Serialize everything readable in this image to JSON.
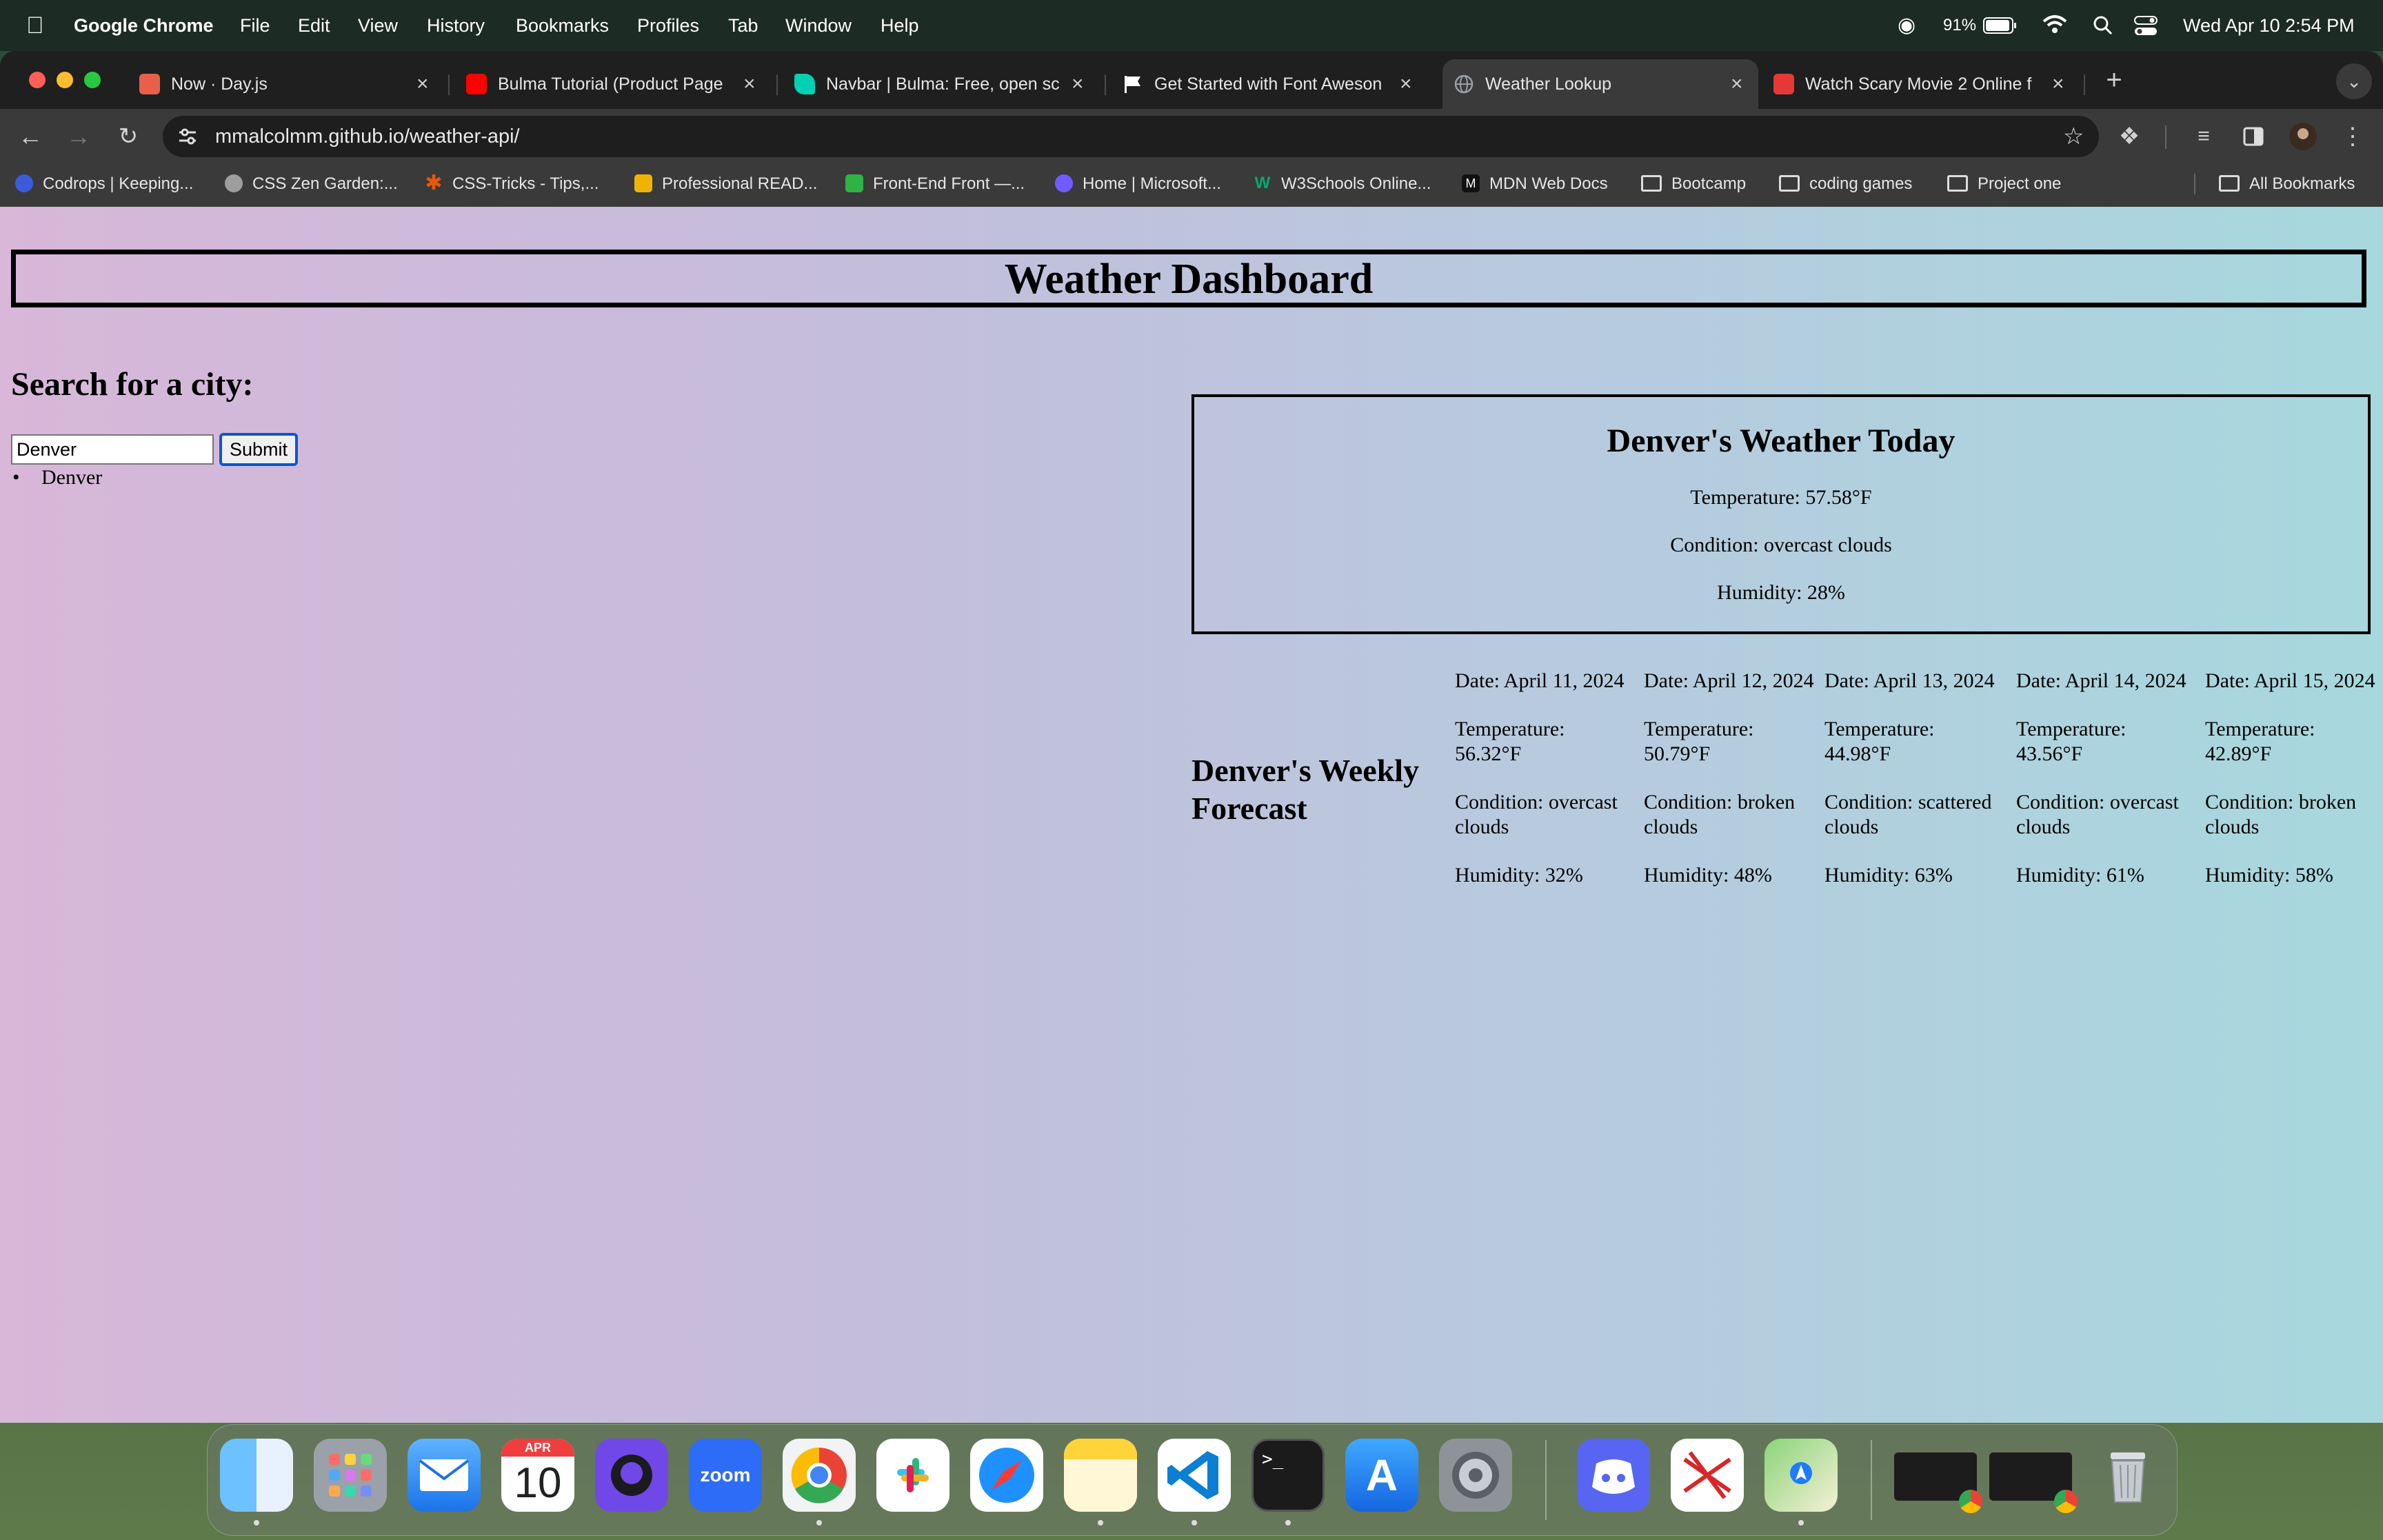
{
  "menubar": {
    "app_name": "Google Chrome",
    "menus": [
      "File",
      "Edit",
      "View",
      "History",
      "Bookmarks",
      "Profiles",
      "Tab",
      "Window",
      "Help"
    ],
    "battery": "91%",
    "datetime": "Wed Apr 10  2:54 PM"
  },
  "tabs": [
    {
      "title": "Now · Day.js",
      "color": "#e8604c"
    },
    {
      "title": "Bulma Tutorial (Product Page",
      "color": "#ff0000"
    },
    {
      "title": "Navbar | Bulma: Free, open sc",
      "color": "#00d1b2"
    },
    {
      "title": "Get Started with Font Aweson",
      "color": "#ffffff"
    },
    {
      "title": "Weather Lookup",
      "color": "#9aa0a6"
    },
    {
      "title": "Watch Scary Movie 2 Online f",
      "color": "#e53935"
    }
  ],
  "active_tab_index": 4,
  "address_bar": {
    "url": "mmalcolmm.github.io/weather-api/"
  },
  "bookmarks": [
    {
      "label": "Codrops | Keeping...",
      "color": "#3b5bdb"
    },
    {
      "label": "CSS Zen Garden:...",
      "color": "#9e9e9e"
    },
    {
      "label": "CSS-Tricks - Tips,...",
      "color": "#e8590c"
    },
    {
      "label": "Professional READ...",
      "color": "#f0b400"
    },
    {
      "label": "Front-End Front —...",
      "color": "#2fb344"
    },
    {
      "label": "Home | Microsoft...",
      "color": "#6f5cff"
    },
    {
      "label": "W3Schools Online...",
      "color": "#04aa6d"
    },
    {
      "label": "MDN Web Docs",
      "color": "#111111"
    },
    {
      "label": "Bootcamp",
      "color": "folder"
    },
    {
      "label": "coding games",
      "color": "folder"
    },
    {
      "label": "Project one",
      "color": "folder"
    }
  ],
  "all_bookmarks_label": "All Bookmarks",
  "page": {
    "title": "Weather Dashboard",
    "search_heading": "Search for a city:",
    "search_value": "Denver",
    "submit_label": "Submit",
    "history": [
      "Denver"
    ],
    "today": {
      "heading": "Denver's Weather Today",
      "temperature": "Temperature: 57.58°F",
      "condition": "Condition: overcast clouds",
      "humidity": "Humidity: 28%"
    },
    "weekly_heading": "Denver's Weekly Forecast",
    "forecast": [
      {
        "date": "Date: April 11, 2024",
        "temperature": "Temperature: 56.32°F",
        "condition": "Condition: overcast clouds",
        "humidity": "Humidity: 32%"
      },
      {
        "date": "Date: April 12, 2024",
        "temperature": "Temperature: 50.79°F",
        "condition": "Condition: broken clouds",
        "humidity": "Humidity: 48%"
      },
      {
        "date": "Date: April 13, 2024",
        "temperature": "Temperature: 44.98°F",
        "condition": "Condition: scattered clouds",
        "humidity": "Humidity: 63%"
      },
      {
        "date": "Date: April 14, 2024",
        "temperature": "Temperature: 43.56°F",
        "condition": "Condition: overcast clouds",
        "humidity": "Humidity: 61%"
      },
      {
        "date": "Date: April 15, 2024",
        "temperature": "Temperature: 42.89°F",
        "condition": "Condition: broken clouds",
        "humidity": "Humidity: 58%"
      }
    ]
  },
  "dock": {
    "calendar_month": "APR",
    "calendar_day": "10",
    "zoom_label": "zoom",
    "apps": [
      "finder-icon",
      "launchpad-icon",
      "mail-icon",
      "calendar-icon",
      "github-desktop-icon",
      "zoom-icon",
      "chrome-icon",
      "slack-icon",
      "safari-icon",
      "notes-icon",
      "vscode-icon",
      "terminal-icon",
      "app-store-icon",
      "system-settings-icon",
      "discord-icon",
      "xmind-icon",
      "maps-icon"
    ]
  }
}
